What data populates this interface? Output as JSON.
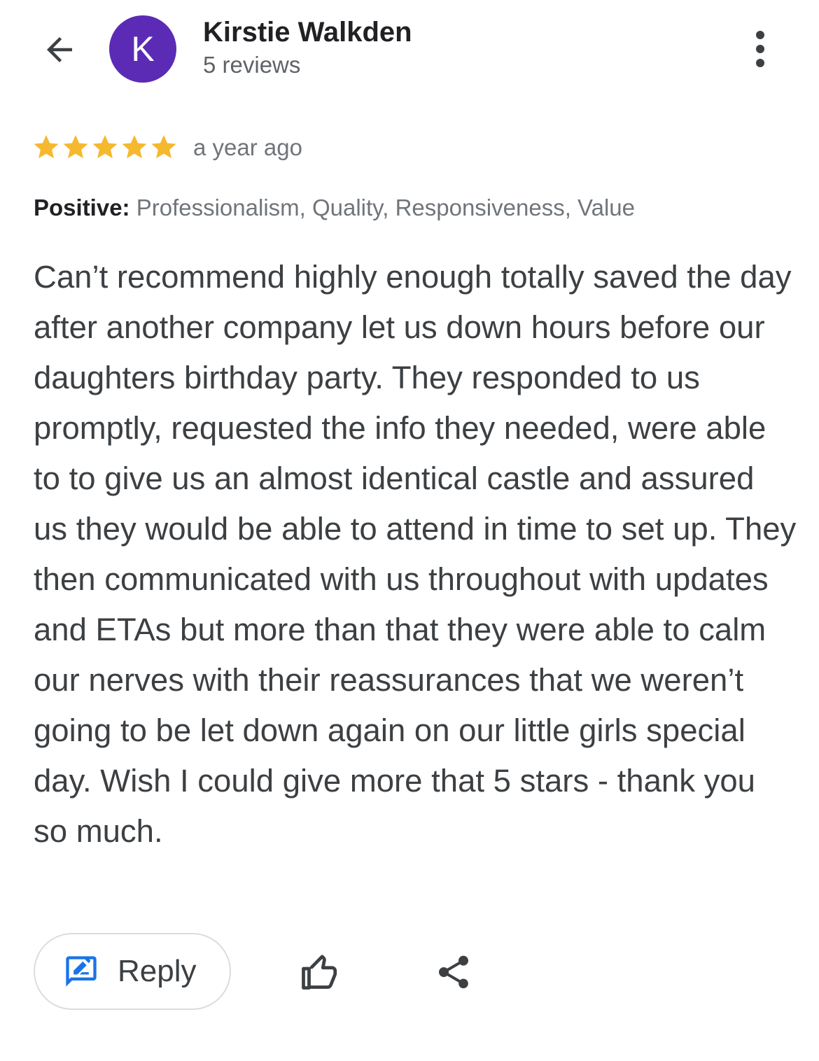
{
  "header": {
    "back_icon": "arrow-left-icon",
    "avatar_letter": "K",
    "avatar_color": "#5b2bb5",
    "reviewer_name": "Kirstie Walkden",
    "review_count": "5 reviews",
    "more_icon": "more-vert-icon"
  },
  "review": {
    "rating": 5,
    "rating_max": 5,
    "star_color": "#f5b82e",
    "timestamp": "a year ago",
    "attributes_label": "Positive:",
    "attributes_values": "Professionalism, Quality, Responsiveness, Value",
    "text": "Can’t recommend highly enough totally saved the day after another company let us down hours before our daughters birthday party. They responded to us promptly, requested the info they needed, were able to to give us an almost identical castle and assured us they would be able to attend in time to set up. They then communicated with us throughout with updates and ETAs but more than that they were able to calm our nerves with their reassurances that we weren’t going to be let down again on our little girls special day. Wish I could give more that 5 stars - thank you so much."
  },
  "actions": {
    "reply_label": "Reply",
    "reply_icon": "rate-review-icon",
    "reply_icon_color": "#1a73e8",
    "like_icon": "thumb-up-icon",
    "share_icon": "share-icon"
  }
}
